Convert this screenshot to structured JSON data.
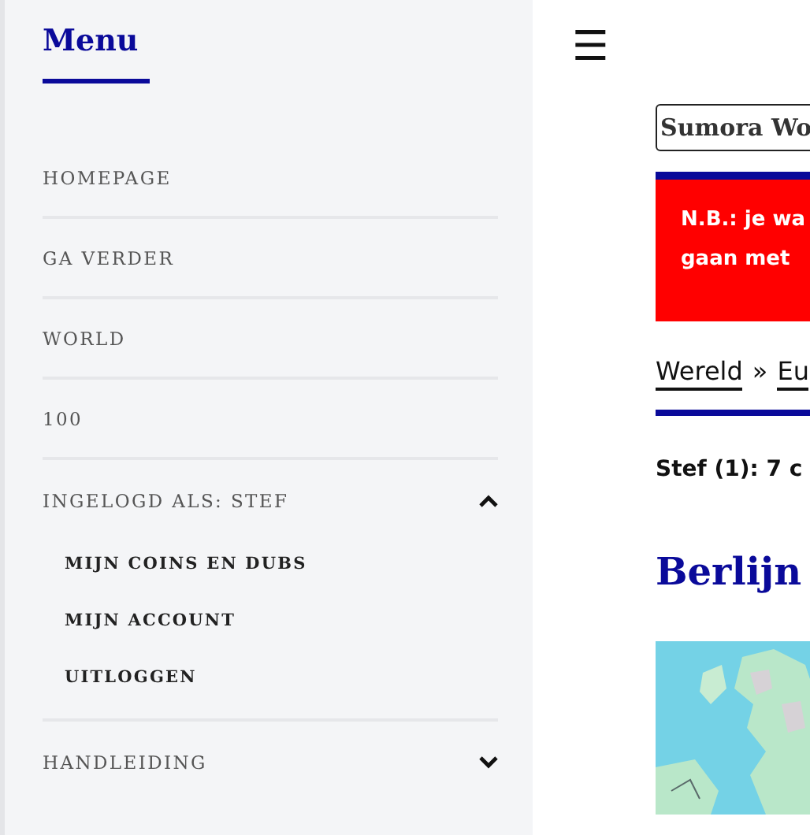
{
  "sidebar": {
    "title": "Menu",
    "items": [
      {
        "label": "HOMEPAGE"
      },
      {
        "label": "GA VERDER"
      },
      {
        "label": "WORLD"
      },
      {
        "label": "100"
      },
      {
        "label": "INGELOGD ALS: STEF",
        "expanded": true,
        "children": [
          {
            "label": "MIJN COINS EN DUBS"
          },
          {
            "label": "MIJN ACCOUNT"
          },
          {
            "label": "UITLOGGEN"
          }
        ]
      },
      {
        "label": "HANDLEIDING",
        "expanded": false
      }
    ]
  },
  "main": {
    "menu_button": "☰",
    "site_button": "Sumora Wo",
    "notice": [
      "N.B.: je wa",
      "gaan met"
    ],
    "breadcrumb": [
      {
        "kind": "link",
        "text": "Wereld"
      },
      {
        "kind": "separator",
        "text": "»"
      },
      {
        "kind": "link",
        "text": "Eu"
      }
    ],
    "owner_line": "Stef (1): 7 c",
    "heading": "Berlijn",
    "map": {
      "kind": "picture"
    }
  }
}
